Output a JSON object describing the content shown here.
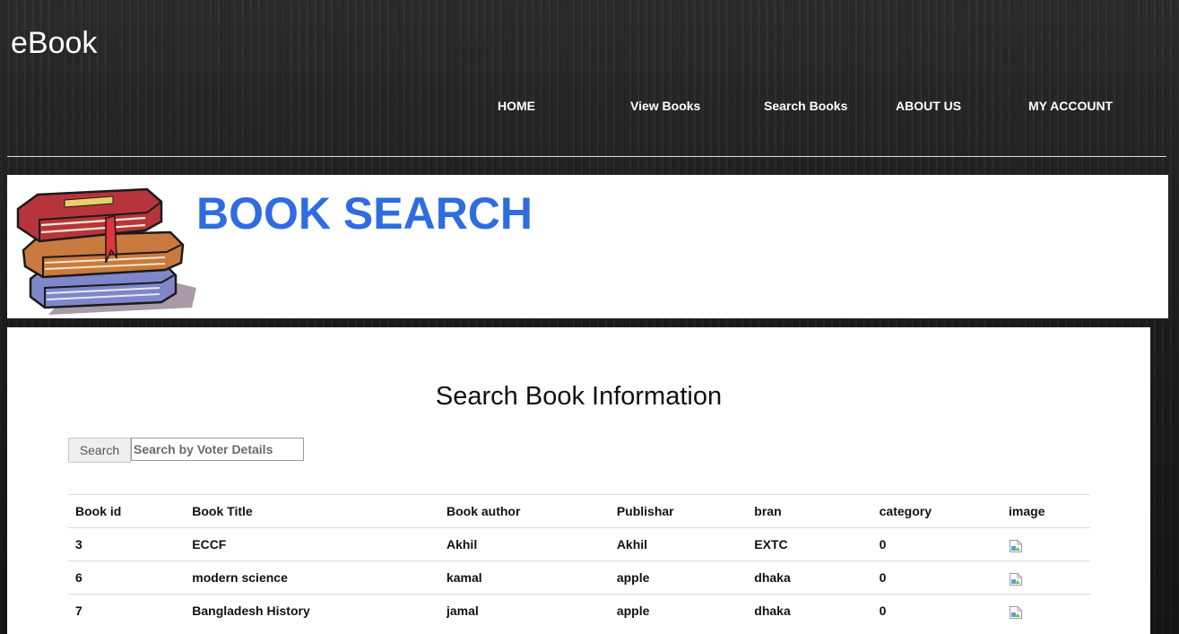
{
  "brand": "eBook",
  "nav": {
    "home": "HOME",
    "view_books": "View Books",
    "search_books": "Search Books",
    "about_us": "ABOUT US",
    "my_account": "MY ACCOUNT"
  },
  "banner": {
    "title": "BOOK SEARCH",
    "title_color": "#2f6ce0",
    "image_icon": "books-stack-icon"
  },
  "panel": {
    "title": "Search Book Information",
    "search_button": "Search",
    "search_placeholder": "Search by Voter Details",
    "search_value": ""
  },
  "table": {
    "headers": [
      "Book id",
      "Book Title",
      "Book author",
      "Publishar",
      "bran",
      "category",
      "image"
    ],
    "rows": [
      {
        "id": "3",
        "title": "ECCF",
        "author": "Akhil",
        "publisher": "Akhil",
        "bran": "EXTC",
        "category": "0",
        "image_icon": "broken-image-icon"
      },
      {
        "id": "6",
        "title": "modern science",
        "author": "kamal",
        "publisher": "apple",
        "bran": "dhaka",
        "category": "0",
        "image_icon": "broken-image-icon"
      },
      {
        "id": "7",
        "title": "Bangladesh History",
        "author": "jamal",
        "publisher": "apple",
        "bran": "dhaka",
        "category": "0",
        "image_icon": "broken-image-icon"
      }
    ]
  }
}
